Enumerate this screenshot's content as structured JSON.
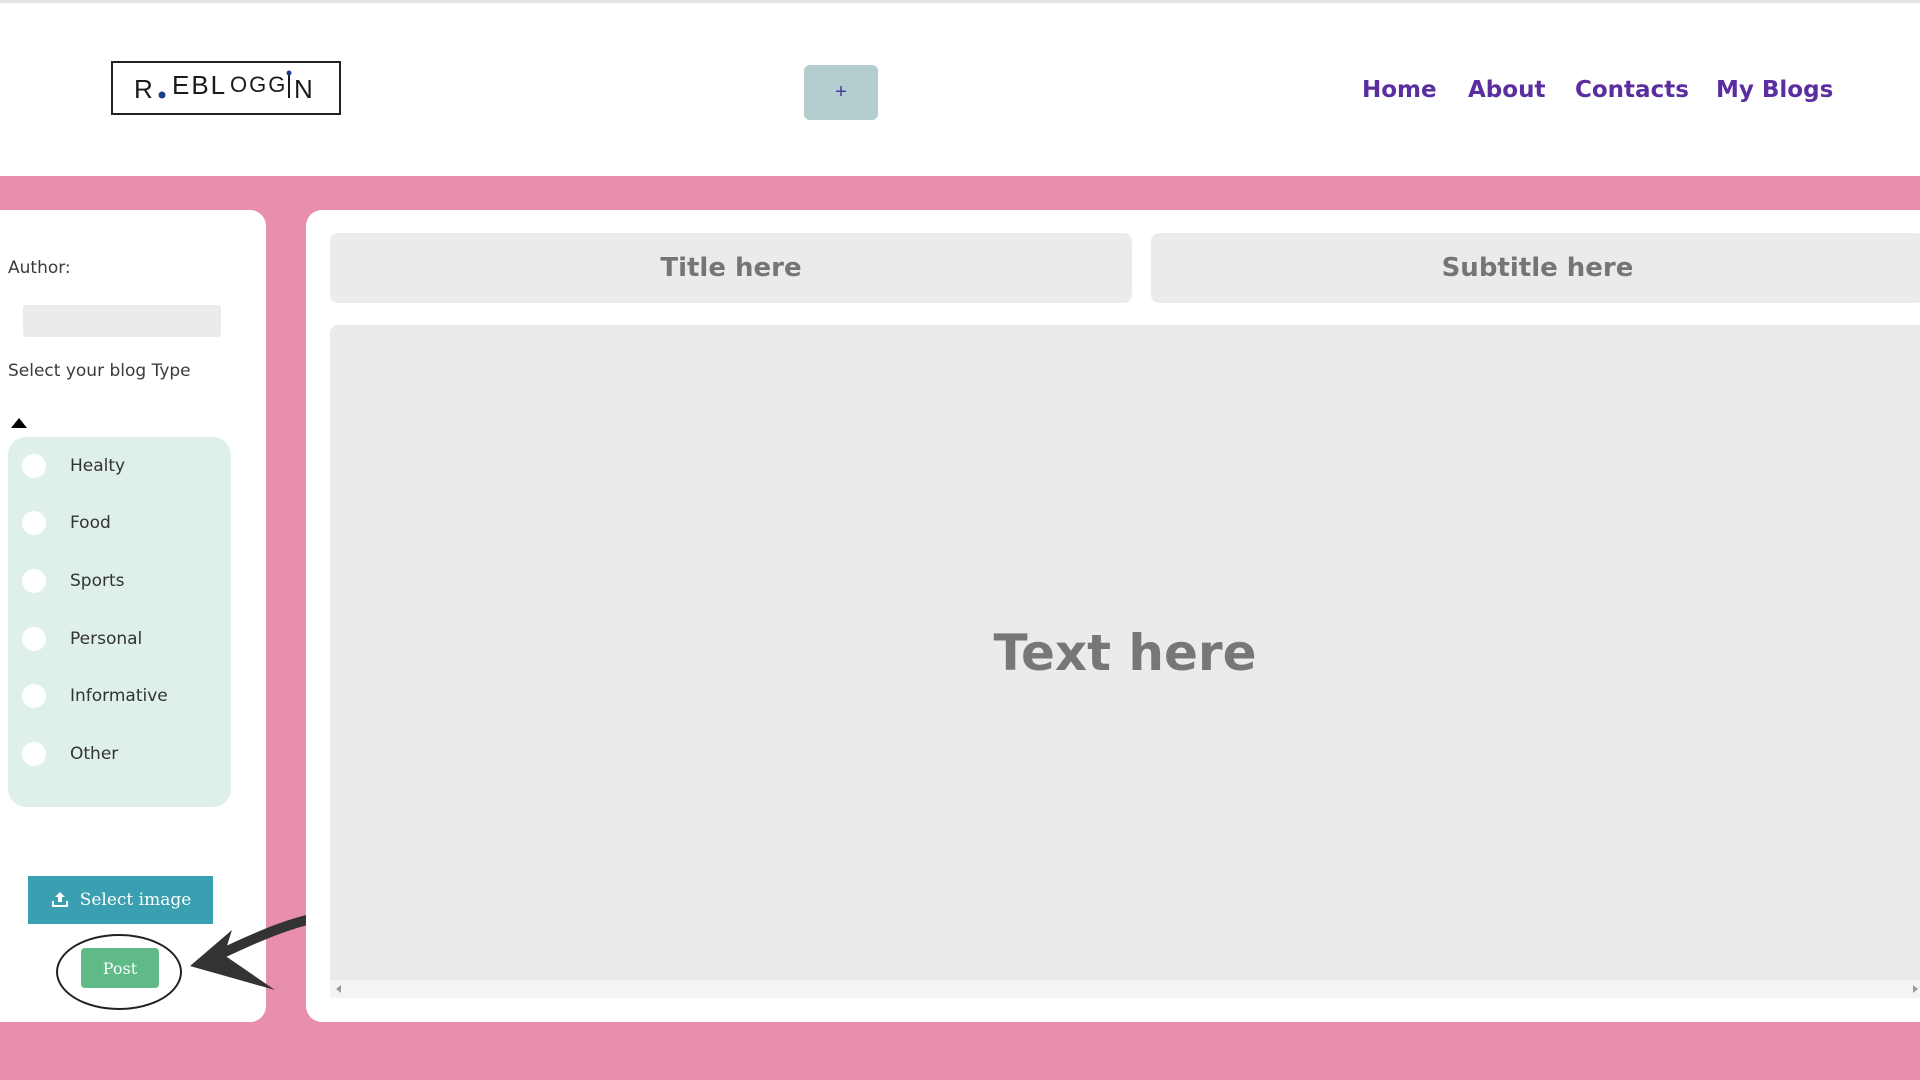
{
  "header": {
    "logo_text": "REBLOGGIN",
    "add_button_label": "+",
    "nav": [
      "Home",
      "About",
      "Contacts",
      "My Blogs"
    ]
  },
  "sidebar": {
    "author_label": "Author:",
    "author_value": "",
    "blog_type_label": "Select your blog Type",
    "blog_types": [
      "Healty",
      "Food",
      "Sports",
      "Personal",
      "Informative",
      "Other"
    ],
    "select_image_label": "Select image",
    "post_label": "Post"
  },
  "editor": {
    "title_placeholder": "Title here",
    "subtitle_placeholder": "Subtitle here",
    "text_placeholder": "Text here"
  },
  "colors": {
    "background_pink": "#e78fab",
    "nav_purple": "#5b2ea0",
    "select_image_teal": "#3a9fb0",
    "post_green": "#5fba88",
    "type_panel_mint": "#deefec"
  },
  "icons": [
    "upload-icon",
    "chevron-up-icon",
    "arrow-annotation"
  ]
}
